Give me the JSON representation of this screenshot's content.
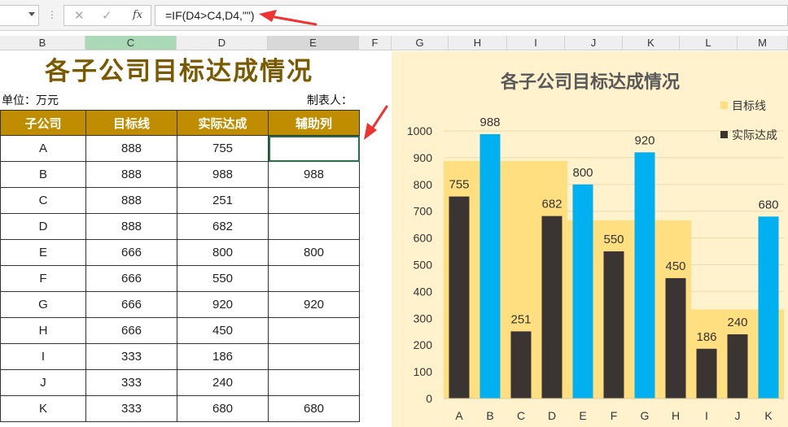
{
  "formula_bar": {
    "formula": "=IF(D4>C4,D4,\"\")",
    "cancel_symbol": "✕",
    "enter_symbol": "✓",
    "fx_label": "fx"
  },
  "columns": [
    "B",
    "C",
    "D",
    "E",
    "F",
    "G",
    "H",
    "I",
    "J",
    "K",
    "L",
    "M"
  ],
  "sheet": {
    "title": "各子公司目标达成情况",
    "unit_label": "单位：万元",
    "maker_label": "制表人：",
    "headers": [
      "子公司",
      "目标线",
      "实际达成",
      "辅助列"
    ],
    "rows": [
      [
        "A",
        "888",
        "755",
        ""
      ],
      [
        "B",
        "888",
        "988",
        "988"
      ],
      [
        "C",
        "888",
        "251",
        ""
      ],
      [
        "D",
        "888",
        "682",
        ""
      ],
      [
        "E",
        "666",
        "800",
        "800"
      ],
      [
        "F",
        "666",
        "550",
        ""
      ],
      [
        "G",
        "666",
        "920",
        "920"
      ],
      [
        "H",
        "666",
        "450",
        ""
      ],
      [
        "I",
        "333",
        "186",
        ""
      ],
      [
        "J",
        "333",
        "240",
        ""
      ],
      [
        "K",
        "333",
        "680",
        "680"
      ]
    ]
  },
  "chart_data": {
    "type": "bar",
    "title": "各子公司目标达成情况",
    "categories": [
      "A",
      "B",
      "C",
      "D",
      "E",
      "F",
      "G",
      "H",
      "I",
      "J",
      "K"
    ],
    "series": [
      {
        "name": "目标线",
        "values": [
          888,
          888,
          888,
          888,
          666,
          666,
          666,
          666,
          333,
          333,
          333
        ],
        "color": "#ffdf80"
      },
      {
        "name": "实际达成",
        "values": [
          755,
          988,
          251,
          682,
          800,
          550,
          920,
          450,
          186,
          240,
          680
        ],
        "color": "#3a3433"
      },
      {
        "name": "",
        "values": [
          null,
          988,
          null,
          null,
          800,
          null,
          920,
          null,
          null,
          null,
          680
        ],
        "color": "#00b0f0"
      }
    ],
    "yticks": [
      0,
      100,
      200,
      300,
      400,
      500,
      600,
      700,
      800,
      900,
      1000
    ],
    "ylim": [
      0,
      1000
    ],
    "grid": true,
    "legend": "top-right"
  },
  "colors": {
    "header_fill": "#c18d00",
    "title_color": "#7a5a00",
    "chart_bg": "#fff2cc",
    "target": "#ffdf80",
    "actual": "#3a3433",
    "highlight": "#00b0f0",
    "arrow": "#ee3333"
  }
}
